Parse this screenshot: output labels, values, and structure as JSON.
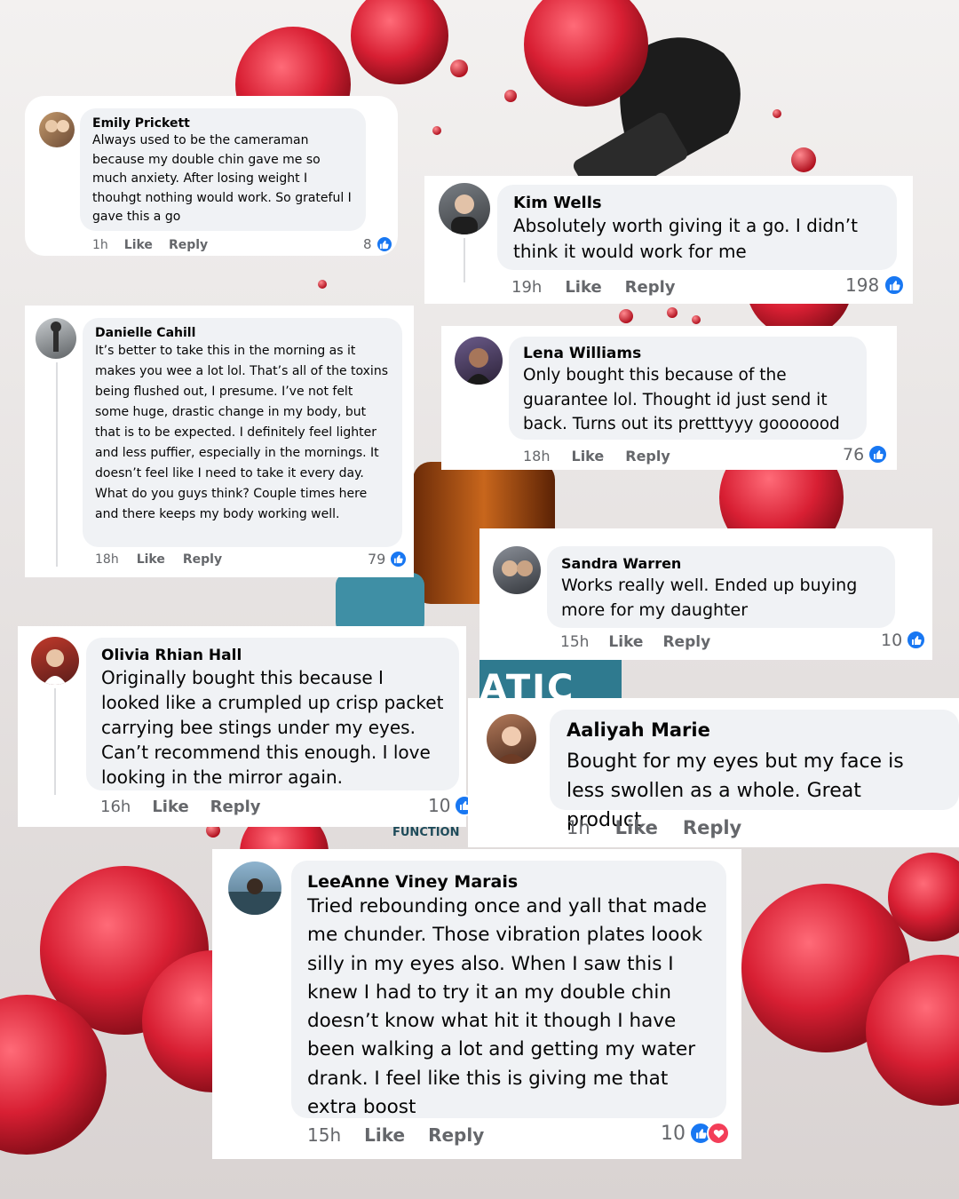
{
  "background_fragments": {
    "partial_label_1": "ATIC",
    "partial_label_2": "FUNCTION"
  },
  "comments": [
    {
      "name": "Emily Prickett",
      "text": "Always used to be the cameraman because my double chin gave me so much anxiety. After losing weight I thouhgt nothing would work. So grateful I gave this a go",
      "time": "1h",
      "like": "Like",
      "reply": "Reply",
      "count": "8"
    },
    {
      "name": "Kim Wells",
      "text": "Absolutely worth giving it a go. I didn’t think it would work for me",
      "time": "19h",
      "like": "Like",
      "reply": "Reply",
      "count": "198"
    },
    {
      "name": "Danielle Cahill",
      "text": "It’s better to take this in the morning as it makes you wee a lot lol. That’s all of the toxins being flushed out, I presume. I’ve not felt some huge, drastic change in my body, but that is to be expected. I definitely feel lighter and less puffier, especially in the mornings. It doesn’t feel like I need to take it every day. What do you guys think? Couple times here and there keeps my body working well.",
      "time": "18h",
      "like": "Like",
      "reply": "Reply",
      "count": "79"
    },
    {
      "name": "Lena Williams",
      "text": "Only bought this because of the guarantee lol. Thought id just send it back. Turns out its pretttyyy gooooood",
      "time": "18h",
      "like": "Like",
      "reply": "Reply",
      "count": "76"
    },
    {
      "name": "Sandra Warren",
      "text": "Works really well. Ended up buying more for my daughter",
      "time": "15h",
      "like": "Like",
      "reply": "Reply",
      "count": "10"
    },
    {
      "name": "Olivia Rhian Hall",
      "text": "Originally bought this because I looked like a crumpled up crisp packet carrying bee stings under my eyes. Can’t recommend this enough. I love looking in the mirror again.",
      "time": "16h",
      "like": "Like",
      "reply": "Reply",
      "count": "10"
    },
    {
      "name": "Aaliyah Marie",
      "text": "Bought for my eyes but my face is less swollen as a whole. Great product",
      "time": "1h",
      "like": "Like",
      "reply": "Reply"
    },
    {
      "name": "LeeAnne Viney Marais",
      "text": "Tried rebounding once and yall that made me chunder. Those vibration plates loook silly in my eyes also. When I saw this I knew I had to try it an my double chin doesn’t know what hit it though I have been walking a lot and getting my water drank. I feel like this is giving me that extra boost",
      "time": "15h",
      "like": "Like",
      "reply": "Reply",
      "count": "10"
    }
  ],
  "colors": {
    "like_blue": "#1877f2",
    "love_red": "#f33e58",
    "meta_gray": "#65676b",
    "bubble_gray": "#f0f2f5"
  },
  "icons": {
    "like": "thumbs-up-icon",
    "love": "heart-icon"
  }
}
